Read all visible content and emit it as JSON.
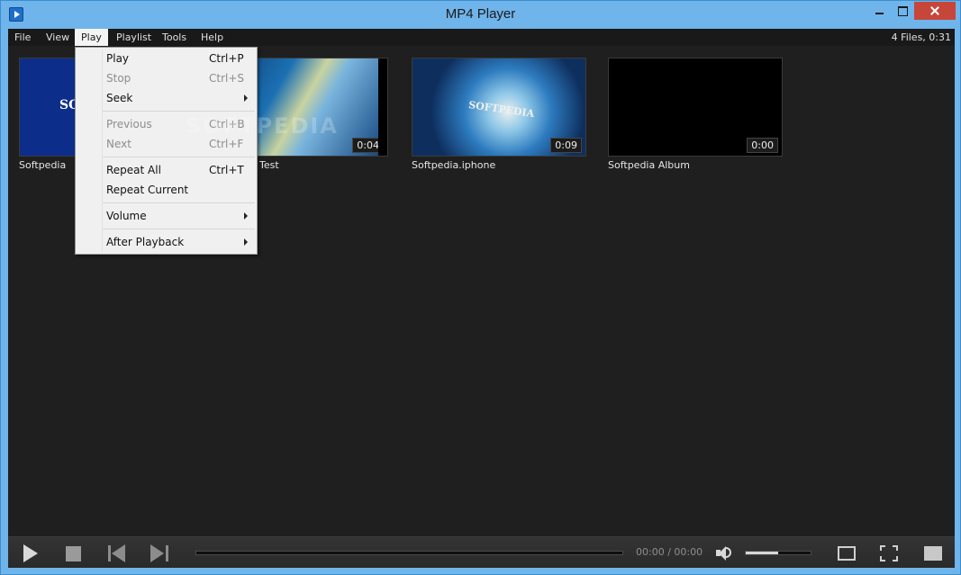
{
  "window": {
    "title": "MP4 Player"
  },
  "menubar": {
    "items": [
      "File",
      "View",
      "Play",
      "Playlist",
      "Tools",
      "Help"
    ],
    "status": "4 Files, 0:31"
  },
  "thumbnails": [
    {
      "label": "Softpedia",
      "duration": "",
      "brand_text": "SO"
    },
    {
      "label": "Test",
      "duration": "0:04"
    },
    {
      "label": "Softpedia.iphone",
      "duration": "0:09",
      "brand_text": "SOFTPEDIA"
    },
    {
      "label": "Softpedia Album",
      "duration": "0:00"
    }
  ],
  "play_menu": {
    "items": [
      {
        "label": "Play",
        "shortcut": "Ctrl+P",
        "disabled": false
      },
      {
        "label": "Stop",
        "shortcut": "Ctrl+S",
        "disabled": true
      },
      {
        "label": "Seek",
        "shortcut": "",
        "submenu": true
      },
      {
        "label": "Previous",
        "shortcut": "Ctrl+B",
        "disabled": true
      },
      {
        "label": "Next",
        "shortcut": "Ctrl+F",
        "disabled": true
      },
      {
        "label": "Repeat All",
        "shortcut": "Ctrl+T",
        "disabled": false
      },
      {
        "label": "Repeat Current",
        "shortcut": "",
        "disabled": false
      },
      {
        "label": "Volume",
        "shortcut": "",
        "submenu": true
      },
      {
        "label": "After Playback",
        "shortcut": "",
        "submenu": true
      }
    ]
  },
  "watermark": "SOFTPEDIA",
  "controls": {
    "time": "00:00 / 00:00",
    "volume_level": 0.5
  },
  "icons": {
    "app": "video-play-icon",
    "play": "play-icon",
    "stop": "stop-icon",
    "previous": "skip-previous-icon",
    "next": "skip-next-icon",
    "volume": "speaker-icon",
    "window_mode": "window-icon",
    "fullscreen": "fullscreen-icon",
    "playlist": "playlist-icon"
  }
}
